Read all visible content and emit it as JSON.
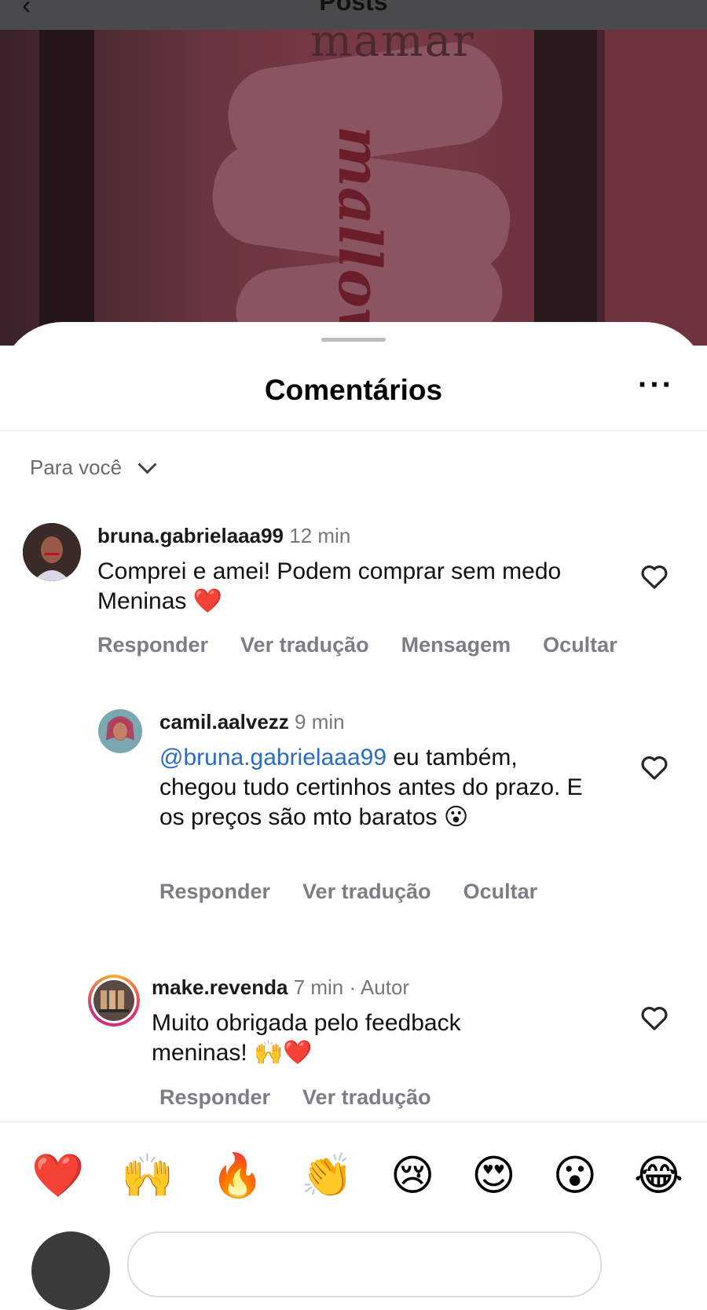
{
  "header": {
    "title": "Posts",
    "back_icon": "chevron-left-icon"
  },
  "background_post": {
    "brand_text": "mamar",
    "script_text": "mallow"
  },
  "sheet": {
    "title": "Comentários",
    "more_icon": "more-horizontal-icon",
    "filter_label": "Para você"
  },
  "comments": [
    {
      "username": "bruna.gabrielaaa99",
      "time": "12 min",
      "text": "Comprei e amei! Podem comprar sem medo Meninas ❤️",
      "actions": [
        "Responder",
        "Ver tradução",
        "Mensagem",
        "Ocultar"
      ]
    },
    {
      "username": "camil.aalvezz",
      "time": "9 min",
      "mention": "@bruna.gabrielaaa99",
      "text": " eu também, chegou tudo certinhos antes do prazo. E os preços são mto baratos 😮",
      "actions": [
        "Responder",
        "Ver tradução",
        "Ocultar"
      ]
    },
    {
      "username": "make.revenda",
      "time": "7 min · Autor",
      "text": "Muito obrigada pelo feedback meninas! 🙌❤️",
      "actions": [
        "Responder",
        "Ver tradução"
      ]
    }
  ],
  "reactions": [
    "❤️",
    "🙌",
    "🔥",
    "👏",
    "😢",
    "😍",
    "😮",
    "😂"
  ],
  "colors": {
    "mention": "#2a6cc4",
    "action_gray": "#7a7f86",
    "heart_red": "#e0102a"
  }
}
